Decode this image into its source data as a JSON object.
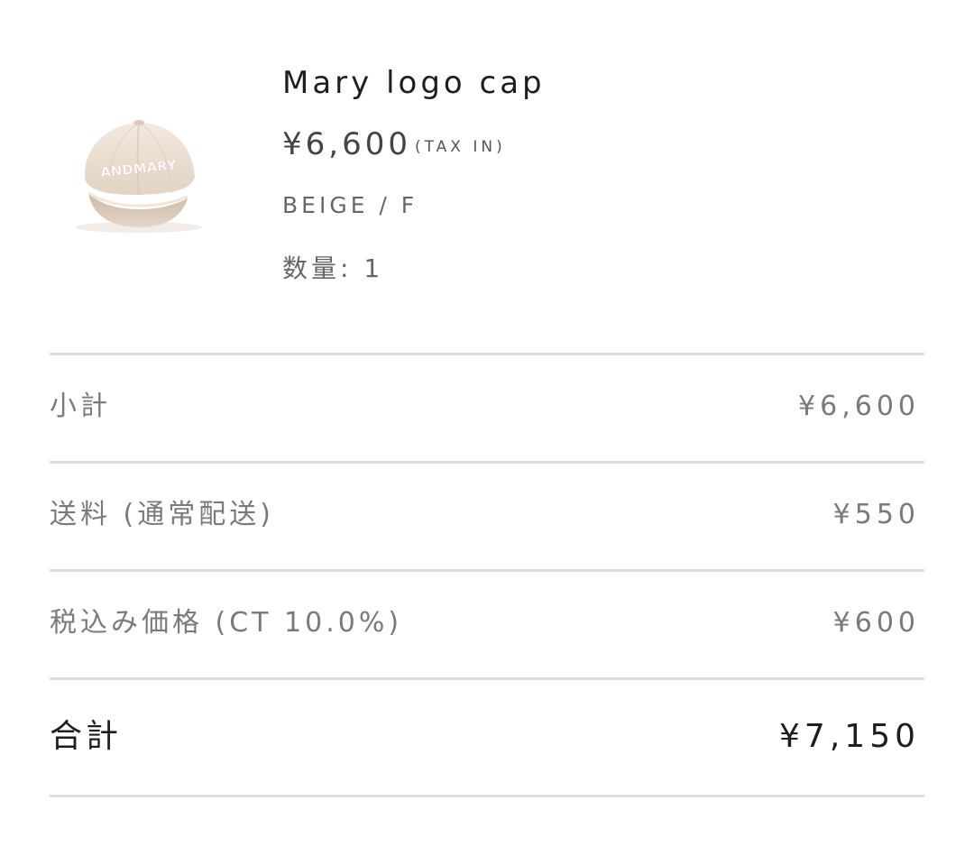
{
  "product": {
    "name": "Mary logo cap",
    "price": "¥6,600",
    "tax_note": "(TAX IN)",
    "variant": "BEIGE / F",
    "quantity": "数量: 1",
    "image_icon": "cap-thumbnail",
    "logo_text": "ANDMARY",
    "cap_color": "#ece0d3"
  },
  "summary": {
    "subtotal_label": "小計",
    "subtotal_value": "¥6,600",
    "shipping_label": "送料 (通常配送)",
    "shipping_value": "¥550",
    "tax_label": "税込み価格 (CT 10.0%)",
    "tax_value": "¥600",
    "total_label": "合計",
    "total_value": "¥7,150"
  },
  "colors": {
    "divider": "#dddddd",
    "text_dark": "#1e1e1e",
    "text_muted": "#7a7a7a"
  }
}
